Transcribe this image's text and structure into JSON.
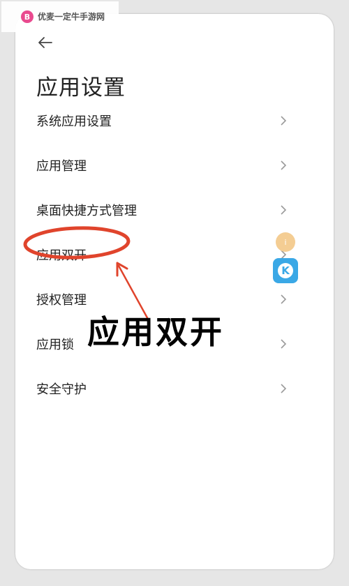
{
  "watermark": {
    "logo": "B",
    "text": "优麦一定牛手游网"
  },
  "header": {
    "title": "应用设置",
    "back_icon": "back-arrow-icon"
  },
  "menu": [
    {
      "label": "系统应用设置"
    },
    {
      "label": "应用管理"
    },
    {
      "label": "桌面快捷方式管理"
    },
    {
      "label": "应用双开"
    },
    {
      "label": "授权管理"
    },
    {
      "label": "应用锁"
    },
    {
      "label": "安全守护"
    }
  ],
  "annotation": {
    "caption": "应用双开",
    "color": "#e0442c"
  },
  "floating": {
    "orange_icon": "i",
    "blue_icon": "K"
  },
  "colors": {
    "background": "#ffffff",
    "chevron": "#9a9a9a",
    "annotation_red": "#e0442c"
  }
}
